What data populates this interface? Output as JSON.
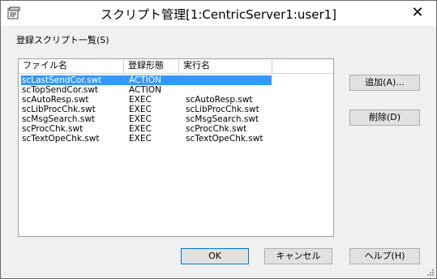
{
  "window": {
    "title": "スクリプト管理[1:CentricServer1:user1]",
    "close_symbol": "✕"
  },
  "section_label": "登録スクリプト一覧(S)",
  "list": {
    "columns": [
      "ファイル名",
      "登録形態",
      "実行名"
    ],
    "rows": [
      {
        "file": "scLastSendCor.swt",
        "type": "ACTION",
        "exec": "",
        "selected": true
      },
      {
        "file": "scTopSendCor.swt",
        "type": "ACTION",
        "exec": ""
      },
      {
        "file": "scAutoResp.swt",
        "type": "EXEC",
        "exec": "scAutoResp.swt"
      },
      {
        "file": "scLibProcChk.swt",
        "type": "EXEC",
        "exec": "scLibProcChk.swt"
      },
      {
        "file": "scMsgSearch.swt",
        "type": "EXEC",
        "exec": "scMsgSearch.swt"
      },
      {
        "file": "scProcChk.swt",
        "type": "EXEC",
        "exec": "scProcChk.swt"
      },
      {
        "file": "scTextOpeChk.swt",
        "type": "EXEC",
        "exec": "scTextOpeChk.swt"
      }
    ]
  },
  "buttons": {
    "add": "追加(A)...",
    "delete": "削除(D)",
    "ok": "OK",
    "cancel": "キャンセル",
    "help": "ヘルプ(H)"
  },
  "colors": {
    "selection": "#3399ff",
    "focus_border": "#0078d7"
  }
}
